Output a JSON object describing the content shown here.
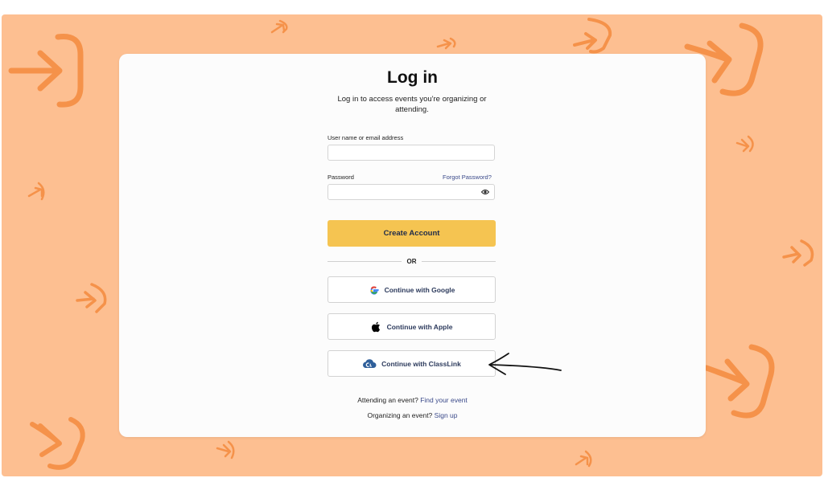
{
  "login": {
    "title": "Log in",
    "subtitle": "Log in to access events you're organizing or attending.",
    "username_label": "User name or email address",
    "username_value": "",
    "password_label": "Password",
    "password_value": "",
    "forgot_password": "Forgot Password?",
    "create_account": "Create Account",
    "divider_text": "OR",
    "google_label": "Continue with Google",
    "apple_label": "Continue with Apple",
    "classlink_label": "Continue with ClassLink",
    "attending_text": "Attending an event?",
    "attending_link": "Find your event",
    "organizing_text": "Organizing an event?",
    "organizing_link": "Sign up"
  },
  "icons": {
    "password_toggle": "eye-icon",
    "google": "google-icon",
    "apple": "apple-icon",
    "classlink": "classlink-icon",
    "annotation": "hand-drawn-arrow-icon",
    "background": "login-arrow-pattern"
  },
  "colors": {
    "background": "#fdbf91",
    "pattern": "#f5924a",
    "primary_button": "#f5c451",
    "link": "#3b4a8a",
    "card": "#fcfcfc"
  }
}
